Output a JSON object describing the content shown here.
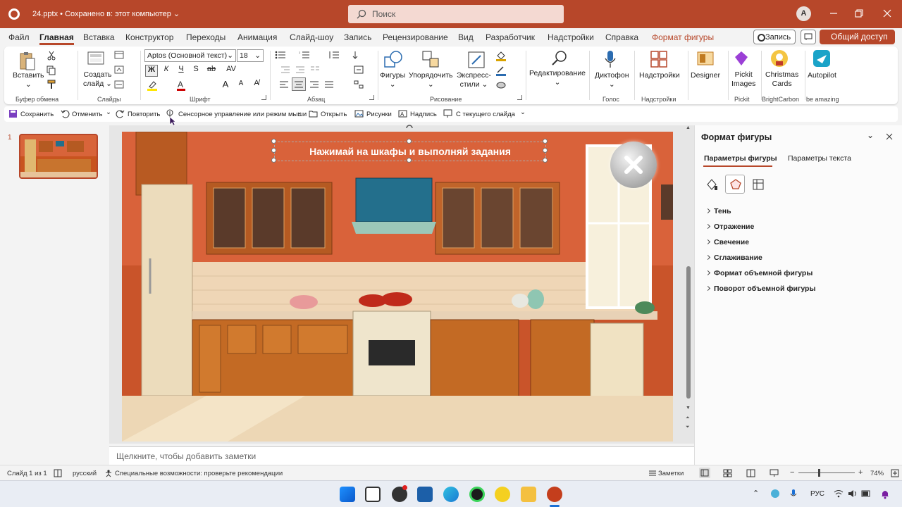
{
  "titlebar": {
    "filename": "24.pptx",
    "saved_status": "Сохранено в: этот компьютер",
    "search_placeholder": "Поиск",
    "user_initial": "A"
  },
  "menu": {
    "tabs": [
      "Файл",
      "Главная",
      "Вставка",
      "Конструктор",
      "Переходы",
      "Анимация",
      "Слайд-шоу",
      "Запись",
      "Рецензирование",
      "Вид",
      "Разработчик",
      "Надстройки",
      "Справка",
      "Формат фигуры"
    ],
    "active": "Главная",
    "record_label": "Запись",
    "share_label": "Общий доступ"
  },
  "ribbon": {
    "clipboard": {
      "paste": "Вставить",
      "group": "Буфер обмена"
    },
    "slides": {
      "new_slide_line1": "Создать",
      "new_slide_line2": "слайд",
      "group": "Слайды"
    },
    "font": {
      "family": "Aptos (Основной текст)",
      "size": "18",
      "group": "Шрифт",
      "bold": "Ж",
      "italic": "К",
      "underline": "Ч",
      "strike": "S",
      "grow": "A",
      "shrink": "A"
    },
    "paragraph": {
      "group": "Абзац"
    },
    "drawing": {
      "shapes": "Фигуры",
      "arrange": "Упорядочить",
      "quick_styles_line1": "Экспресс-",
      "quick_styles_line2": "стили",
      "group": "Рисование"
    },
    "editing": {
      "label": "Редактирование"
    },
    "voice": {
      "dictate": "Диктофон",
      "group": "Голос"
    },
    "addins": {
      "label": "Надстройки",
      "group": "Надстройки"
    },
    "designer": {
      "label": "Designer"
    },
    "pickit": {
      "line1": "Pickit",
      "line2": "Images",
      "group": "Pickit"
    },
    "christmas": {
      "line1": "Christmas",
      "line2": "Cards",
      "group": "BrightCarbon"
    },
    "autopilot": {
      "label": "Autopilot",
      "group": "be amazing"
    }
  },
  "qat": {
    "items": [
      "Сохранить",
      "Отменить",
      "Повторить",
      "Сенсорное управление или режим мыши",
      "Открыть",
      "Рисунки",
      "Надпись",
      "С текущего слайда"
    ]
  },
  "thumbnails": {
    "slide_number": "1"
  },
  "slide": {
    "title_text": "Нажимай на шкафы и выполняй задания"
  },
  "notes": {
    "placeholder": "Щелкните, чтобы добавить заметки"
  },
  "format_pane": {
    "title": "Формат фигуры",
    "tabs": [
      "Параметры фигуры",
      "Параметры текста"
    ],
    "sections": [
      "Тень",
      "Отражение",
      "Свечение",
      "Сглаживание",
      "Формат объемной фигуры",
      "Поворот объемной фигуры"
    ]
  },
  "status": {
    "slide_of": "Слайд 1 из 1",
    "language": "русский",
    "accessibility": "Специальные возможности: проверьте рекомендации",
    "notes_btn": "Заметки",
    "zoom": "74%",
    "zoom_fraction": 0.37
  },
  "taskbar": {
    "lang": "РУС"
  }
}
